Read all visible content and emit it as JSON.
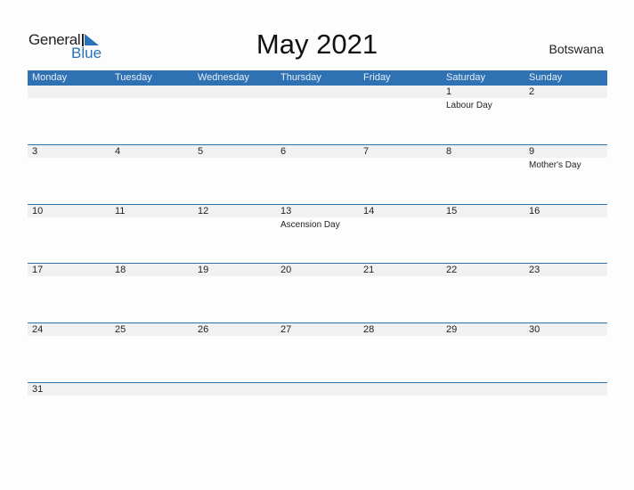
{
  "logo": {
    "general": "General",
    "blue": "Blue",
    "accent_color": "#2a72bb"
  },
  "title": "May 2021",
  "country": "Botswana",
  "header_color": "#2e72b4",
  "weekdays": [
    "Monday",
    "Tuesday",
    "Wednesday",
    "Thursday",
    "Friday",
    "Saturday",
    "Sunday"
  ],
  "weeks": [
    [
      {
        "day": ""
      },
      {
        "day": ""
      },
      {
        "day": ""
      },
      {
        "day": ""
      },
      {
        "day": ""
      },
      {
        "day": "1",
        "holiday": "Labour Day"
      },
      {
        "day": "2"
      }
    ],
    [
      {
        "day": "3"
      },
      {
        "day": "4"
      },
      {
        "day": "5"
      },
      {
        "day": "6"
      },
      {
        "day": "7"
      },
      {
        "day": "8"
      },
      {
        "day": "9",
        "holiday": "Mother's Day"
      }
    ],
    [
      {
        "day": "10"
      },
      {
        "day": "11"
      },
      {
        "day": "12"
      },
      {
        "day": "13",
        "holiday": "Ascension Day"
      },
      {
        "day": "14"
      },
      {
        "day": "15"
      },
      {
        "day": "16"
      }
    ],
    [
      {
        "day": "17"
      },
      {
        "day": "18"
      },
      {
        "day": "19"
      },
      {
        "day": "20"
      },
      {
        "day": "21"
      },
      {
        "day": "22"
      },
      {
        "day": "23"
      }
    ],
    [
      {
        "day": "24"
      },
      {
        "day": "25"
      },
      {
        "day": "26"
      },
      {
        "day": "27"
      },
      {
        "day": "28"
      },
      {
        "day": "29"
      },
      {
        "day": "30"
      }
    ],
    [
      {
        "day": "31"
      },
      {
        "day": ""
      },
      {
        "day": ""
      },
      {
        "day": ""
      },
      {
        "day": ""
      },
      {
        "day": ""
      },
      {
        "day": ""
      }
    ]
  ]
}
